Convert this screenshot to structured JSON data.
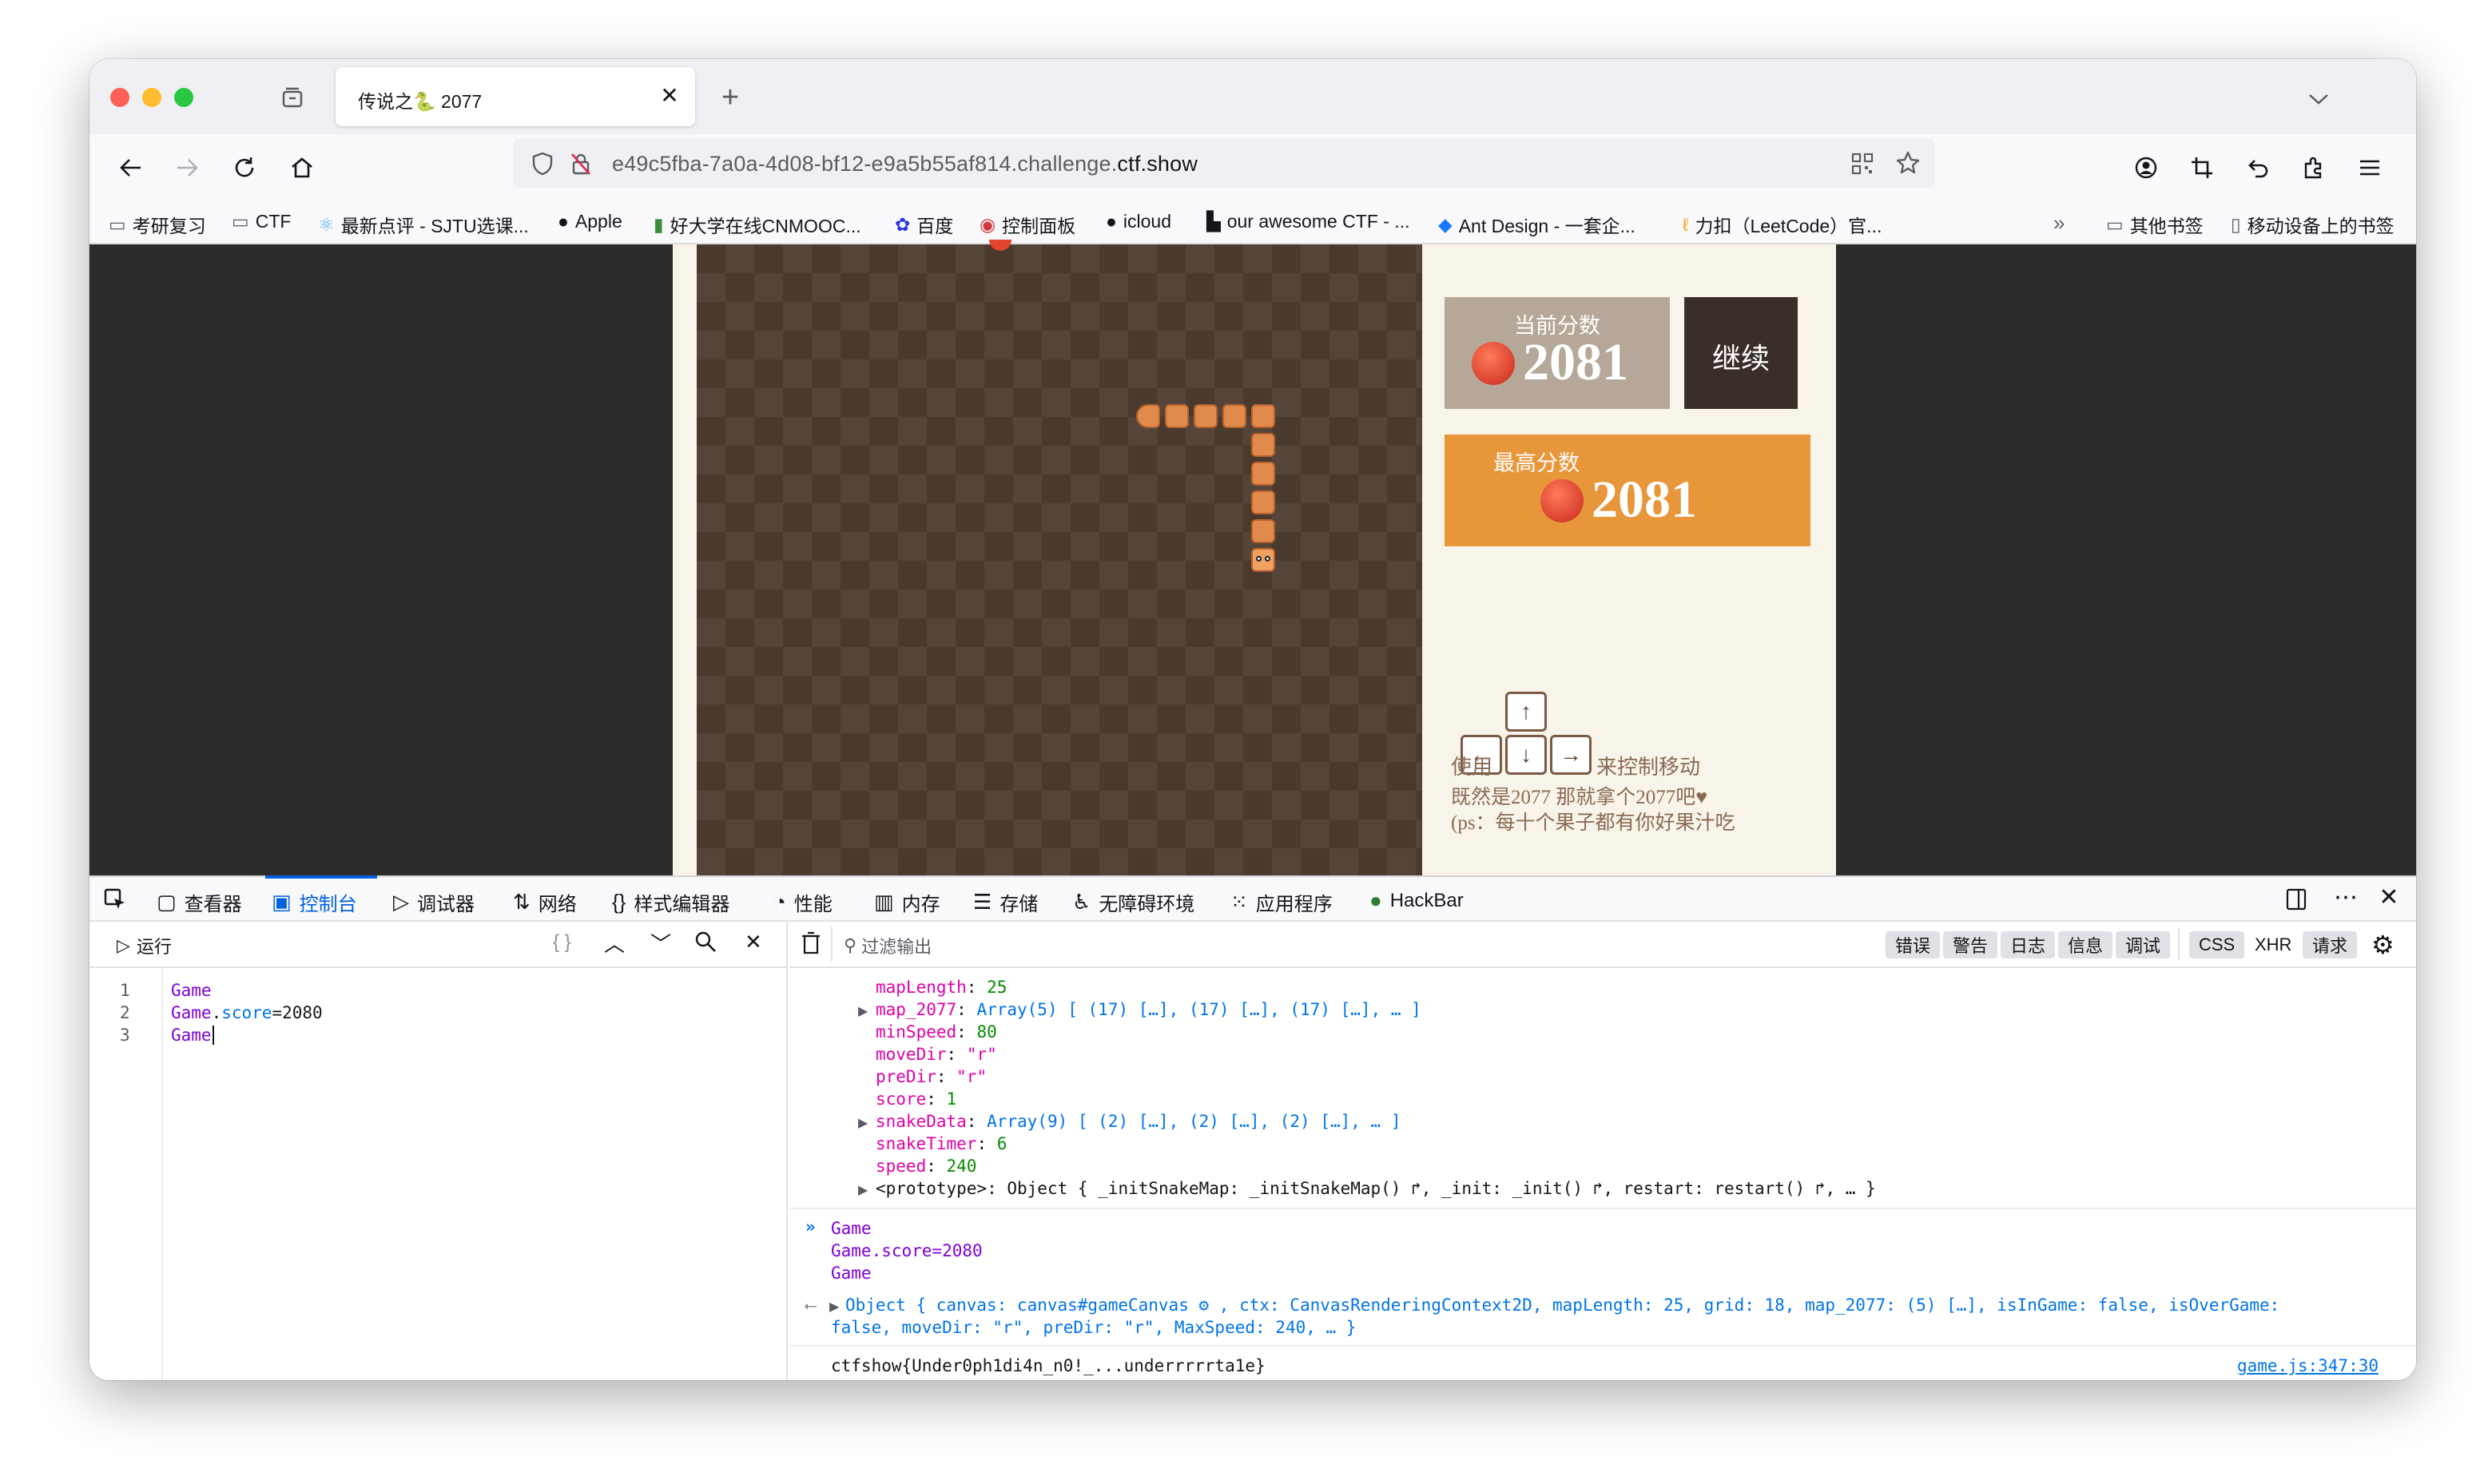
{
  "browser": {
    "tab_title": "传说之🐍 2077",
    "url_prefix": "e49c5fba-7a0a-4d08-bf12-e9a5b55af814.challenge.",
    "url_domain": "ctf.show",
    "new_tab_icon": "plus-icon",
    "bookmarks": [
      {
        "label": "考研复习",
        "icon": "folder-icon"
      },
      {
        "label": "CTF",
        "icon": "folder-icon"
      },
      {
        "label": "最新点评 - SJTU选课...",
        "icon": "react-icon"
      },
      {
        "label": "Apple",
        "icon": "apple-icon"
      },
      {
        "label": "好大学在线CNMOOC...",
        "icon": "book-icon"
      },
      {
        "label": "百度",
        "icon": "baidu-icon"
      },
      {
        "label": "控制面板",
        "icon": "panel-icon"
      },
      {
        "label": "icloud",
        "icon": "apple-icon"
      },
      {
        "label": "our awesome CTF - ...",
        "icon": "page-icon"
      },
      {
        "label": "Ant Design - 一套企...",
        "icon": "ant-icon"
      },
      {
        "label": "力扣（LeetCode）官...",
        "icon": "leetcode-icon"
      }
    ],
    "other_bookmarks": "其他书签",
    "mobile_bookmarks": "移动设备上的书签"
  },
  "game": {
    "current_score_label": "当前分数",
    "current_score": "2081",
    "continue_label": "继续",
    "high_score_label": "最高分数",
    "high_score": "2081",
    "instructions_line1_prefix": "使用",
    "instructions_line1_suffix": "来控制移动",
    "instructions_line2": "既然是2077 那就拿个2077吧♥",
    "instructions_line3": "(ps：每十个果子都有你好果汁吃",
    "colors": {
      "score_box": "#b5a898",
      "continue_box": "#3a2f28",
      "high_box": "#e8963a",
      "board_dark": "#4a3a2e",
      "snake": "#e08a4c"
    }
  },
  "devtools": {
    "tabs": [
      {
        "label": "查看器",
        "icon": "inspector-icon"
      },
      {
        "label": "控制台",
        "icon": "console-icon",
        "selected": true
      },
      {
        "label": "调试器",
        "icon": "debugger-icon"
      },
      {
        "label": "网络",
        "icon": "network-icon"
      },
      {
        "label": "样式编辑器",
        "icon": "style-editor-icon"
      },
      {
        "label": "性能",
        "icon": "performance-icon"
      },
      {
        "label": "内存",
        "icon": "memory-icon"
      },
      {
        "label": "存储",
        "icon": "storage-icon"
      },
      {
        "label": "无障碍环境",
        "icon": "accessibility-icon"
      },
      {
        "label": "应用程序",
        "icon": "application-icon"
      },
      {
        "label": "HackBar",
        "icon": "hackbar-icon"
      }
    ],
    "run_label": "运行",
    "filter_placeholder": "过滤输出",
    "filter_chips": [
      "错误",
      "警告",
      "日志",
      "信息",
      "调试",
      "CSS",
      "XHR",
      "请求"
    ],
    "editor_lines": [
      {
        "num": "1",
        "text": "Game"
      },
      {
        "num": "2",
        "text_obj": "Game",
        "text_dot": ".",
        "text_prop": "score",
        "text_val": "=2080"
      },
      {
        "num": "3",
        "text": "Game"
      }
    ],
    "object_props": [
      {
        "key": "mapLength",
        "value": "25",
        "type": "num"
      },
      {
        "key": "map_2077",
        "value": "Array(5) [ (17) […], (17) […], (17) […], … ]",
        "type": "arr",
        "expandable": true
      },
      {
        "key": "minSpeed",
        "value": "80",
        "type": "num"
      },
      {
        "key": "moveDir",
        "value": "\"r\"",
        "type": "str"
      },
      {
        "key": "preDir",
        "value": "\"r\"",
        "type": "str"
      },
      {
        "key": "score",
        "value": "1",
        "type": "num"
      },
      {
        "key": "snakeData",
        "value": "Array(9) [ (2) […], (2) […], (2) […], … ]",
        "type": "arr",
        "expandable": true
      },
      {
        "key": "snakeTimer",
        "value": "6",
        "type": "num"
      },
      {
        "key": "speed",
        "value": "240",
        "type": "num"
      },
      {
        "key": "<prototype>",
        "value": "Object { _initSnakeMap: _initSnakeMap() ↱, _init: _init() ↱, restart: restart() ↱, … }",
        "type": "proto",
        "expandable": true
      }
    ],
    "input_echo": [
      "Game",
      "Game.score=2080",
      "Game"
    ],
    "result_line1": "Object { canvas: canvas#gameCanvas ⚙ , ctx: CanvasRenderingContext2D, mapLength: 25, grid: 18, map_2077: (5) […], isInGame: false, isOverGame:",
    "result_line2": "false, moveDir: \"r\", preDir: \"r\", MaxSpeed: 240, … }",
    "log_output": "ctfshow{Under0ph1di4n_n0!_...underrrrrta1e}",
    "log_source": "game.js:347:30"
  }
}
